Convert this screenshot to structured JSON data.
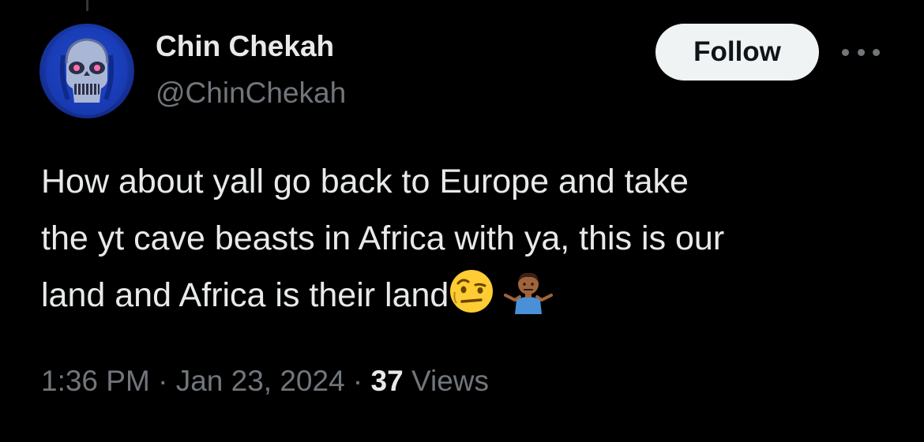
{
  "colors": {
    "background": "#000000",
    "primary_text": "#e7e9ea",
    "secondary_text": "#71767b",
    "follow_button_bg": "#eff3f4",
    "follow_button_text": "#0f1419"
  },
  "author": {
    "display_name": "Chin Chekah",
    "handle": "@ChinChekah",
    "avatar_icon": "blue-skull-avatar"
  },
  "actions": {
    "follow_label": "Follow",
    "more_icon": "more-dots-icon"
  },
  "tweet": {
    "lines": [
      "How about yall go back to Europe and take",
      "the yt cave beasts in Africa with ya, this is our",
      "land and Africa is their land"
    ],
    "emojis": [
      "raised-eyebrow-face",
      "person-shrugging-medium-dark"
    ]
  },
  "meta": {
    "time": "1:36 PM",
    "sep1": " · ",
    "date": "Jan 23, 2024",
    "sep2": " · ",
    "views_count": "37",
    "views_label": " Views"
  }
}
